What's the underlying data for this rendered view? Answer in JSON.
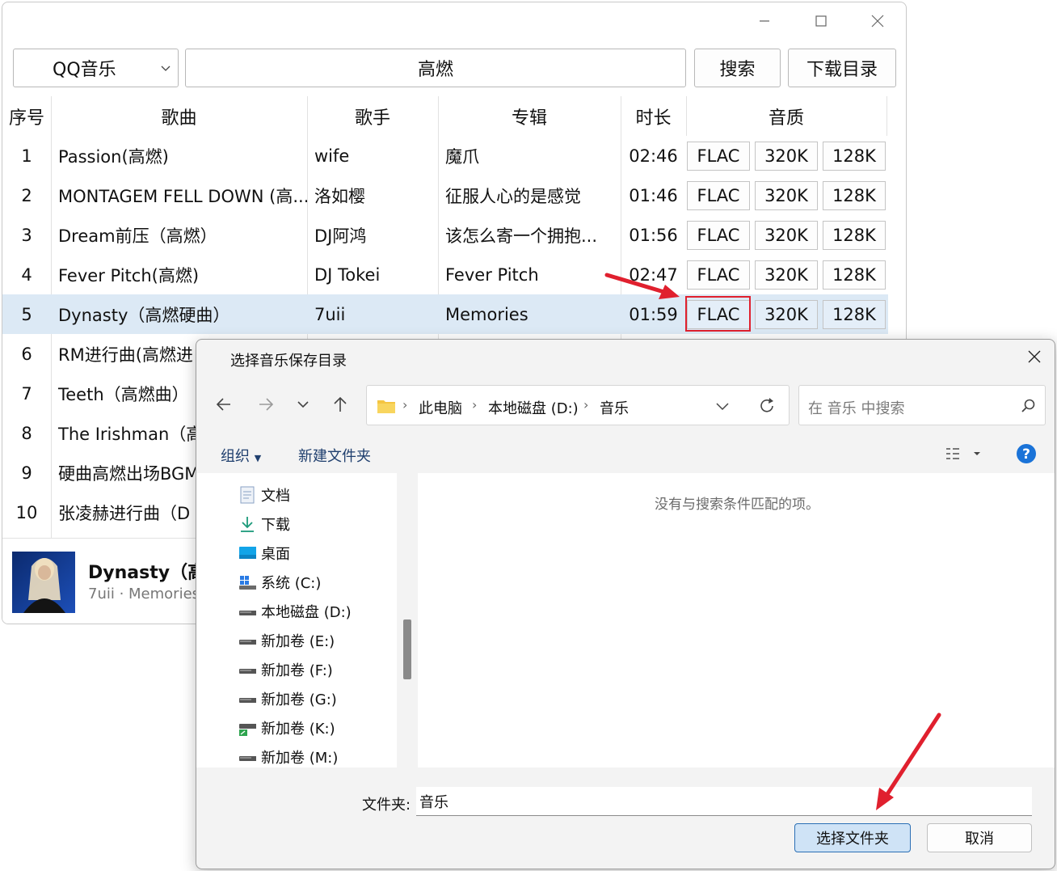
{
  "app": {
    "source_select": "QQ音乐",
    "search_value": "高燃",
    "search_button": "搜索",
    "download_dir_button": "下载目录",
    "columns": [
      "序号",
      "歌曲",
      "歌手",
      "专辑",
      "时长",
      "音质"
    ],
    "quality_options": [
      "FLAC",
      "320K",
      "128K"
    ],
    "selected_row": 4,
    "rows": [
      {
        "index": "1",
        "song": "Passion(高燃)",
        "artist": "wife",
        "album": "魔爪",
        "duration": "02:46"
      },
      {
        "index": "2",
        "song": "MONTAGEM FELL DOWN (高...",
        "artist": "洛如樱",
        "album": "征服人心的是感觉",
        "duration": "01:46"
      },
      {
        "index": "3",
        "song": "Dream前压（高燃）",
        "artist": "DJ阿鸿",
        "album": "该怎么寄一个拥抱...",
        "duration": "01:56"
      },
      {
        "index": "4",
        "song": "Fever Pitch(高燃)",
        "artist": "DJ Tokei",
        "album": "Fever Pitch",
        "duration": "02:47"
      },
      {
        "index": "5",
        "song": "Dynasty（高燃硬曲）",
        "artist": "7uii",
        "album": "Memories",
        "duration": "01:59"
      },
      {
        "index": "6",
        "song": "RM进行曲(高燃进",
        "artist": "",
        "album": "",
        "duration": ""
      },
      {
        "index": "7",
        "song": "Teeth（高燃曲）",
        "artist": "",
        "album": "",
        "duration": ""
      },
      {
        "index": "8",
        "song": "The Irishman（高",
        "artist": "",
        "album": "",
        "duration": ""
      },
      {
        "index": "9",
        "song": "硬曲高燃出场BGM",
        "artist": "",
        "album": "",
        "duration": ""
      },
      {
        "index": "10",
        "song": "张凌赫进行曲（D",
        "artist": "",
        "album": "",
        "duration": ""
      }
    ],
    "now_playing": {
      "title": "Dynasty（高燃",
      "subtitle": "7uii · Memories"
    }
  },
  "dialog": {
    "title": "选择音乐保存目录",
    "breadcrumb": [
      "此电脑",
      "本地磁盘 (D:)",
      "音乐"
    ],
    "search_placeholder": "在 音乐 中搜索",
    "organize_label": "组织",
    "new_folder_label": "新建文件夹",
    "tree": [
      {
        "label": "文档",
        "icon": "document-icon"
      },
      {
        "label": "下载",
        "icon": "download-icon"
      },
      {
        "label": "桌面",
        "icon": "desktop-icon"
      },
      {
        "label": "系统 (C:)",
        "icon": "system-drive-icon"
      },
      {
        "label": "本地磁盘 (D:)",
        "icon": "drive-icon"
      },
      {
        "label": "新加卷 (E:)",
        "icon": "drive-icon"
      },
      {
        "label": "新加卷 (F:)",
        "icon": "drive-icon"
      },
      {
        "label": "新加卷 (G:)",
        "icon": "drive-icon"
      },
      {
        "label": "新加卷 (K:)",
        "icon": "network-drive-icon"
      },
      {
        "label": "新加卷 (M:)",
        "icon": "drive-icon"
      }
    ],
    "empty_message": "没有与搜索条件匹配的项。",
    "folder_label": "文件夹:",
    "folder_value": "音乐",
    "select_button": "选择文件夹",
    "cancel_button": "取消"
  },
  "colors": {
    "selection": "#dce9f5",
    "highlight": "#e0202e",
    "primary_button": "#cfe3f6",
    "help": "#1a73d8"
  }
}
